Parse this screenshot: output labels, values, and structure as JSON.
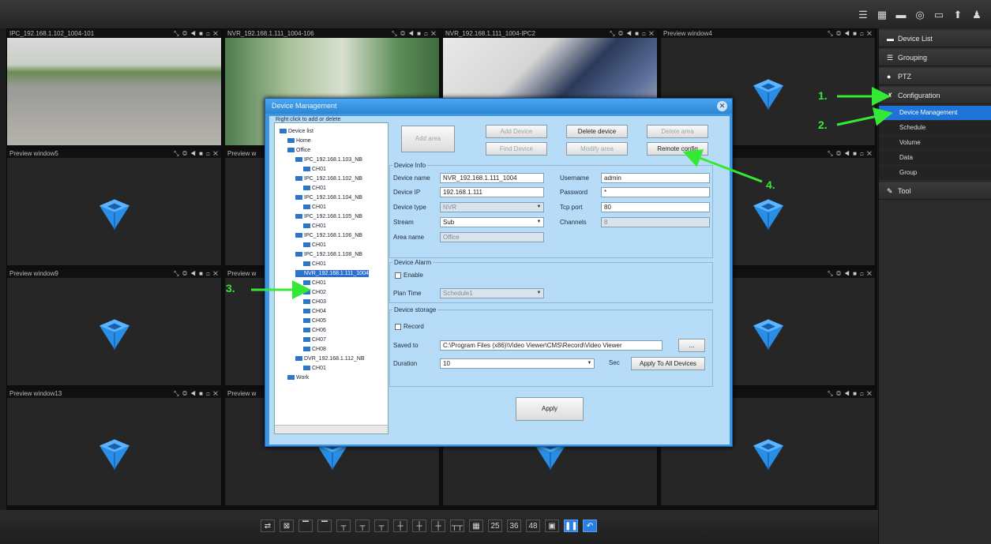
{
  "topbar": {
    "icons": [
      "list-icon",
      "layout-icon",
      "camera-icon",
      "record-icon",
      "window-icon",
      "pin-icon",
      "user-icon"
    ]
  },
  "cells": [
    {
      "title": "IPC_192.168.1.102_1004-101",
      "controls": "⤡ ◎ ◀ ■ ◻ ✕",
      "feed": "parking"
    },
    {
      "title": "NVR_192.168.1.111_1004-106",
      "controls": "⤡ ◎ ◀ ■ ◻ ✕",
      "feed": "room"
    },
    {
      "title": "NVR_192.168.1.111_1004-IPC2",
      "controls": "⤡ ◎ ◀ ■ ◻ ✕",
      "feed": "office"
    },
    {
      "title": "Preview window4",
      "controls": "⤡ ◎ ◀ ■ ◻ ✕",
      "feed": "empty"
    },
    {
      "title": "Preview window5",
      "controls": "⤡ ◎ ◀ ■ ◻ ✕",
      "feed": "empty"
    },
    {
      "title": "Preview w",
      "controls": "",
      "feed": "empty"
    },
    {
      "title": "",
      "controls": "",
      "feed": "empty"
    },
    {
      "title": "",
      "controls": "⤡ ◎ ◀ ■ ◻ ✕",
      "feed": "empty"
    },
    {
      "title": "Preview window9",
      "controls": "⤡ ◎ ◀ ■ ◻ ✕",
      "feed": "empty"
    },
    {
      "title": "Preview w",
      "controls": "",
      "feed": "empty"
    },
    {
      "title": "",
      "controls": "",
      "feed": "empty"
    },
    {
      "title": "",
      "controls": "⤡ ◎ ◀ ■ ◻ ✕",
      "feed": "empty"
    },
    {
      "title": "Preview window13",
      "controls": "⤡ ◎ ◀ ■ ◻ ✕",
      "feed": "empty"
    },
    {
      "title": "Preview w",
      "controls": "",
      "feed": "empty"
    },
    {
      "title": "",
      "controls": "",
      "feed": "empty"
    },
    {
      "title": "",
      "controls": "⤡ ◎ ◀ ■ ◻ ✕",
      "feed": "empty"
    }
  ],
  "sidebar": {
    "items": [
      {
        "label": "Device List",
        "icon": "device-list-icon",
        "glyph": "▬"
      },
      {
        "label": "Grouping",
        "icon": "grouping-icon",
        "glyph": "☰"
      },
      {
        "label": "PTZ",
        "icon": "ptz-icon",
        "glyph": "●"
      },
      {
        "label": "Configuration",
        "icon": "wrench-icon",
        "glyph": "✗"
      }
    ],
    "subitems": [
      "Device Management",
      "Schedule",
      "Volume",
      "Data",
      "Group"
    ],
    "tool_label": "Tool",
    "tool_glyph": "✎"
  },
  "bottombar": {
    "buttons": [
      "⇄",
      "⊠",
      "▔",
      "▔",
      "┬",
      "┬",
      "┬",
      "┼",
      "┼",
      "┼",
      "┬┬",
      "▦",
      "25",
      "36",
      "48",
      "▣",
      "❚❚",
      "↶"
    ]
  },
  "dialog": {
    "title": "Device Management",
    "close": "✕",
    "tree": {
      "header": "Right click to add or delete",
      "nodes": [
        {
          "label": "Device list",
          "level": 0
        },
        {
          "label": "Home",
          "level": 1
        },
        {
          "label": "Office",
          "level": 1
        },
        {
          "label": "IPC_192.168.1.103_NB",
          "level": 2
        },
        {
          "label": "CH01",
          "level": 3
        },
        {
          "label": "IPC_192.168.1.102_NB",
          "level": 2
        },
        {
          "label": "CH01",
          "level": 3
        },
        {
          "label": "IPC_192.168.1.104_NB",
          "level": 2
        },
        {
          "label": "CH01",
          "level": 3
        },
        {
          "label": "IPC_192.168.1.105_NB",
          "level": 2
        },
        {
          "label": "CH01",
          "level": 3
        },
        {
          "label": "IPC_192.168.1.106_NB",
          "level": 2
        },
        {
          "label": "CH01",
          "level": 3
        },
        {
          "label": "IPC_192.168.1.108_NB",
          "level": 2
        },
        {
          "label": "CH01",
          "level": 3
        },
        {
          "label": "NVR_192.168.1.111_1004",
          "level": 2,
          "selected": true
        },
        {
          "label": "CH01",
          "level": 3
        },
        {
          "label": "CH02",
          "level": 3
        },
        {
          "label": "CH03",
          "level": 3
        },
        {
          "label": "CH04",
          "level": 3
        },
        {
          "label": "CH05",
          "level": 3
        },
        {
          "label": "CH06",
          "level": 3
        },
        {
          "label": "CH07",
          "level": 3
        },
        {
          "label": "CH08",
          "level": 3
        },
        {
          "label": "DVR_192.168.1.112_NB",
          "level": 2
        },
        {
          "label": "CH01",
          "level": 3
        },
        {
          "label": "Work",
          "level": 1
        }
      ]
    },
    "buttons": {
      "add_area": "Add area",
      "add_device": "Add Device",
      "delete_device": "Delete device",
      "delete_area": "Delete area",
      "find_device": "Find Device",
      "modify_area": "Modify area",
      "remote_config": "Remote config",
      "apply": "Apply",
      "apply_all": "Apply To All Devices",
      "browse": "..."
    },
    "device_info": {
      "legend": "Device Info",
      "device_name_label": "Device name",
      "device_name": "NVR_192.168.1.111_1004",
      "device_ip_label": "Device IP",
      "device_ip": "192.168.1.111",
      "device_type_label": "Device type",
      "device_type": "NVR",
      "stream_label": "Stream",
      "stream": "Sub",
      "area_name_label": "Area name",
      "area_name": "Office",
      "username_label": "Username",
      "username": "admin",
      "password_label": "Password",
      "password": "*",
      "tcp_port_label": "Tcp port",
      "tcp_port": "80",
      "channels_label": "Channels",
      "channels": "8"
    },
    "device_alarm": {
      "legend": "Device Alarm",
      "enable_label": "Enable",
      "plan_time_label": "Plan Time",
      "plan_time": "Schedule1"
    },
    "device_storage": {
      "legend": "Device storage",
      "rec_label": "Record",
      "save_to_label": "Saved to",
      "save_to": "C:\\Program Files (x86)\\Video Viewer\\CMS\\Record\\Video Viewer",
      "duration_label": "Duration",
      "duration": "10",
      "duration_unit": "Sec"
    }
  },
  "annotations": [
    "1.",
    "2.",
    "3.",
    "4."
  ],
  "colors": {
    "arrow": "#35e835",
    "accent": "#1e73d8",
    "dialog": "#3d96e0"
  }
}
